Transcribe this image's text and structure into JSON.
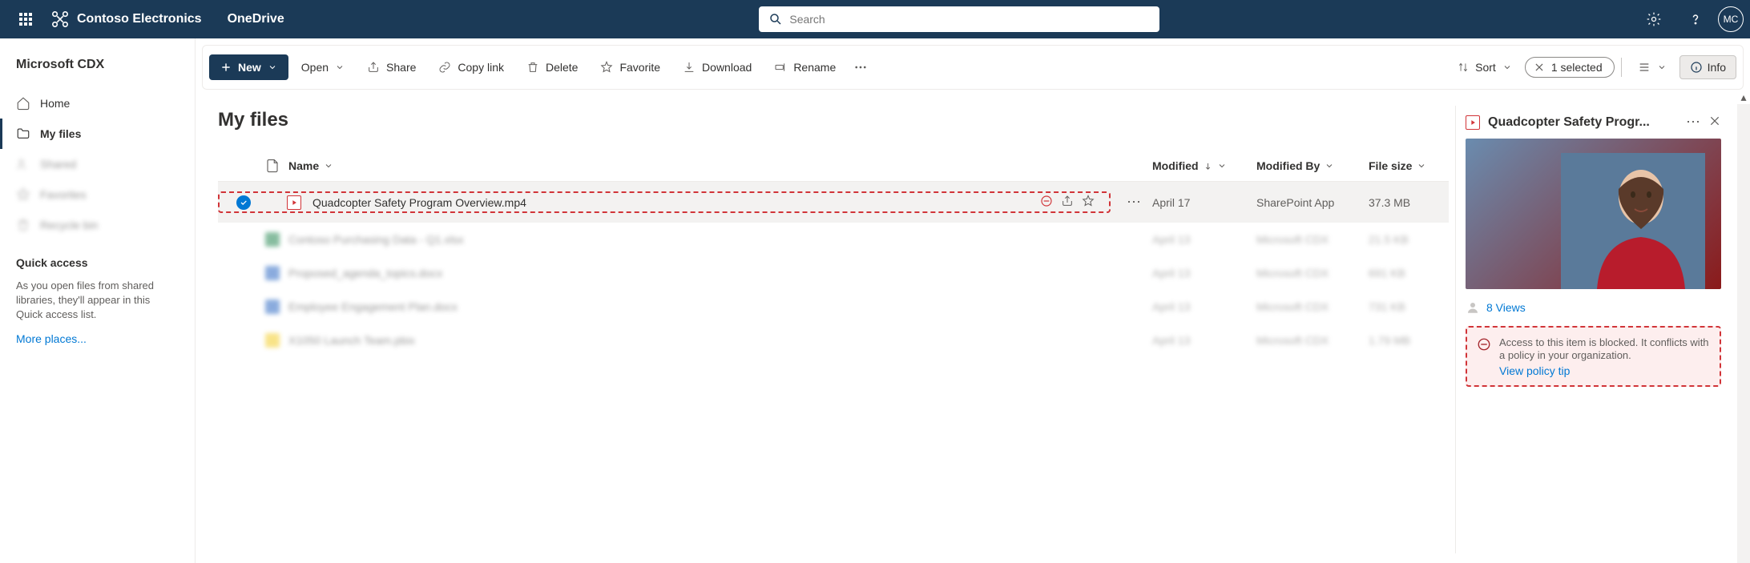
{
  "header": {
    "brand": "Contoso Electronics",
    "app": "OneDrive",
    "search_placeholder": "Search",
    "avatar_initials": "MC"
  },
  "sidebar": {
    "tenant": "Microsoft CDX",
    "items": [
      {
        "label": "Home",
        "icon": "home"
      },
      {
        "label": "My files",
        "icon": "folder",
        "selected": true
      },
      {
        "label": "Shared",
        "icon": "people",
        "faded": true
      },
      {
        "label": "Favorites",
        "icon": "star",
        "faded": true
      },
      {
        "label": "Recycle bin",
        "icon": "trash",
        "faded": true
      }
    ],
    "quick_title": "Quick access",
    "quick_desc": "As you open files from shared libraries, they'll appear in this Quick access list.",
    "more": "More places..."
  },
  "toolbar": {
    "new_label": "New",
    "items": [
      {
        "label": "Open",
        "chevron": true
      },
      {
        "label": "Share",
        "icon": "share"
      },
      {
        "label": "Copy link",
        "icon": "link"
      },
      {
        "label": "Delete",
        "icon": "trash"
      },
      {
        "label": "Favorite",
        "icon": "star"
      },
      {
        "label": "Download",
        "icon": "download"
      },
      {
        "label": "Rename",
        "icon": "rename"
      }
    ],
    "sort_label": "Sort",
    "selected_count": "1 selected",
    "info_label": "Info"
  },
  "page_title": "My files",
  "columns": {
    "name": "Name",
    "modified": "Modified",
    "by": "Modified By",
    "size": "File size"
  },
  "files": [
    {
      "name": "Quadcopter Safety Program Overview.mp4",
      "type": "video",
      "modified": "April 17",
      "by": "SharePoint App",
      "size": "37.3 MB",
      "selected": true
    },
    {
      "name": "Contoso Purchasing Data - Q1.xlsx",
      "type": "excel",
      "modified": "April 13",
      "by": "Microsoft CDX",
      "size": "21.5 KB",
      "faded": true
    },
    {
      "name": "Proposed_agenda_topics.docx",
      "type": "word",
      "modified": "April 13",
      "by": "Microsoft CDX",
      "size": "691 KB",
      "faded": true
    },
    {
      "name": "Employee Engagement Plan.docx",
      "type": "word",
      "modified": "April 13",
      "by": "Microsoft CDX",
      "size": "731 KB",
      "faded": true
    },
    {
      "name": "X1050 Launch Team.pbix",
      "type": "pbix",
      "modified": "April 13",
      "by": "Microsoft CDX",
      "size": "1.79 MB",
      "faded": true
    }
  ],
  "details": {
    "title": "Quadcopter Safety Progr...",
    "views": "8 Views",
    "policy_text": "Access to this item is blocked. It conflicts with a policy in your organization.",
    "policy_link": "View policy tip"
  }
}
